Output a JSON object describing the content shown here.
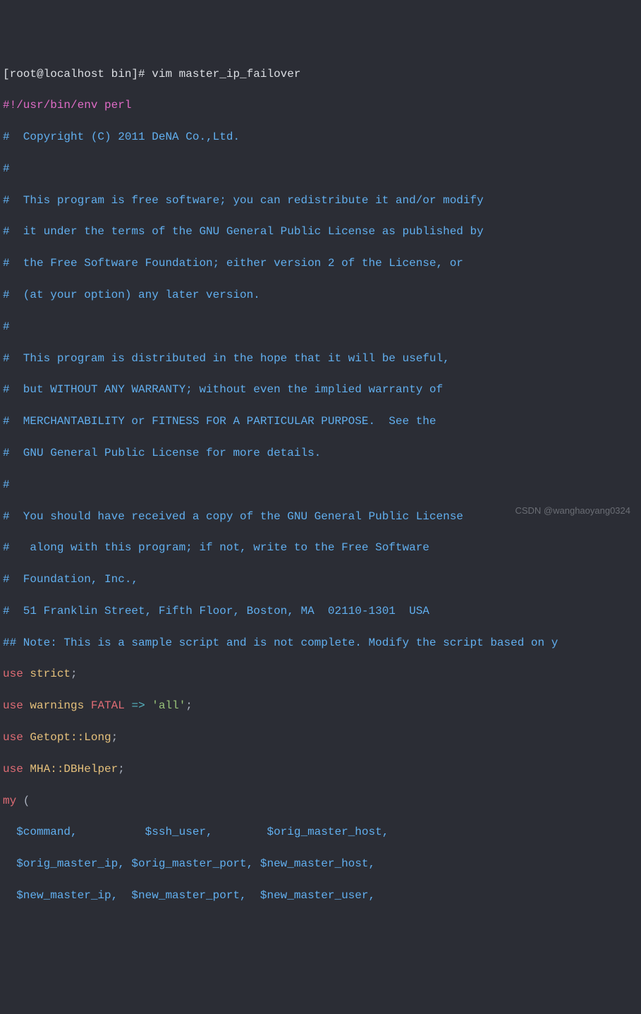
{
  "prompt": {
    "user_host": "[root@localhost bin]# ",
    "command": "vim master_ip_failover"
  },
  "shebang": "#!/usr/bin/env perl",
  "comments": {
    "c1": "#  Copyright (C) 2011 DeNA Co.,Ltd.",
    "c2": "#",
    "c3": "#  This program is free software; you can redistribute it and/or modify",
    "c4": "#  it under the terms of the GNU General Public License as published by",
    "c5": "#  the Free Software Foundation; either version 2 of the License, or",
    "c6": "#  (at your option) any later version.",
    "c7": "#",
    "c8": "#  This program is distributed in the hope that it will be useful,",
    "c9": "#  but WITHOUT ANY WARRANTY; without even the implied warranty of",
    "c10": "#  MERCHANTABILITY or FITNESS FOR A PARTICULAR PURPOSE.  See the",
    "c11": "#  GNU General Public License for more details.",
    "c12": "#",
    "c13": "#  You should have received a copy of the GNU General Public License",
    "c14": "#   along with this program; if not, write to the Free Software",
    "c15": "#  Foundation, Inc.,",
    "c16": "#  51 Franklin Street, Fifth Floor, Boston, MA  02110-1301  USA",
    "note": "## Note: This is a sample script and is not complete. Modify the script based on y"
  },
  "code": {
    "use": "use",
    "strict": "strict",
    "warnings": "warnings",
    "fatal": "FATAL",
    "arrow": "=>",
    "all": "'all'",
    "getopt": "Getopt::Long",
    "mha": "MHA::DBHelper",
    "my": "my",
    "semi": ";",
    "open_paren": " (",
    "var_line1": "  $command,          $ssh_user,        $orig_master_host,",
    "var_line2": "  $orig_master_ip, $orig_master_port, $new_master_host,",
    "var_line3": "  $new_master_ip,  $new_master_port,  $new_master_user,"
  },
  "watermark": "CSDN @wanghaoyang0324"
}
